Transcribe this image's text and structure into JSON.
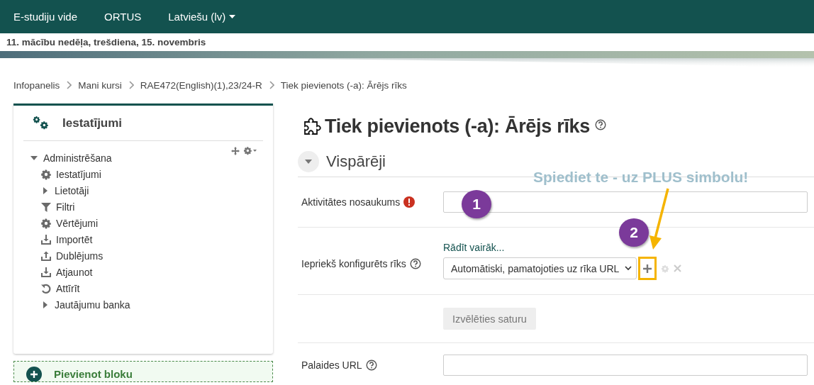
{
  "navbar": {
    "items": [
      {
        "label": "E-studiju vide",
        "kind": "link"
      },
      {
        "label": "ORTUS",
        "kind": "link"
      },
      {
        "label": "Latviešu (lv)",
        "kind": "dropdown"
      }
    ]
  },
  "date_bar": "11. mācību nedēļa, trešdiena, 15. novembris",
  "breadcrumb": [
    "Infopanelis",
    "Mani kursi",
    "RAE472(English)(1),23/24-R",
    "Tiek pievienots (-a): Ārējs rīks"
  ],
  "settings_block": {
    "title": "Iestatījumi",
    "tree": [
      {
        "label": "Administrēšana",
        "kind": "branch",
        "expanded": true,
        "children": [
          {
            "label": "Iestatījumi",
            "kind": "gear"
          },
          {
            "label": "Lietotāji",
            "kind": "branch",
            "expanded": false
          },
          {
            "label": "Filtri",
            "kind": "filter"
          },
          {
            "label": "Vērtējumi",
            "kind": "gear"
          },
          {
            "label": "Importēt",
            "kind": "download"
          },
          {
            "label": "Dublējums",
            "kind": "upload"
          },
          {
            "label": "Atjaunot",
            "kind": "download"
          },
          {
            "label": "Attīrīt",
            "kind": "reset"
          },
          {
            "label": "Jautājumu banka",
            "kind": "branch",
            "expanded": false
          }
        ]
      }
    ]
  },
  "add_block": {
    "label": "Pievienot bloku"
  },
  "page_title": "Tiek pievienots (-a): Ārējs rīks",
  "section": {
    "title": "Vispārēji",
    "expanded": true
  },
  "form_rows": [
    {
      "kind": "text",
      "label": "Aktivitātes nosaukums",
      "required": true,
      "help": false
    },
    {
      "kind": "select",
      "label": "Iepriekš konfigurēts rīks",
      "help": true,
      "link": "Rādīt vairāk...",
      "value": "Automātiski, pamatojoties uz rīka URL"
    },
    {
      "kind": "button",
      "button": "Izvēlēties saturu",
      "disabled": true
    },
    {
      "kind": "text",
      "label": "Palaides URL",
      "required": false,
      "help": true
    }
  ],
  "annotations": {
    "caption": "Spiediet te - uz PLUS simbolu!",
    "markers": [
      "1",
      "2"
    ]
  }
}
